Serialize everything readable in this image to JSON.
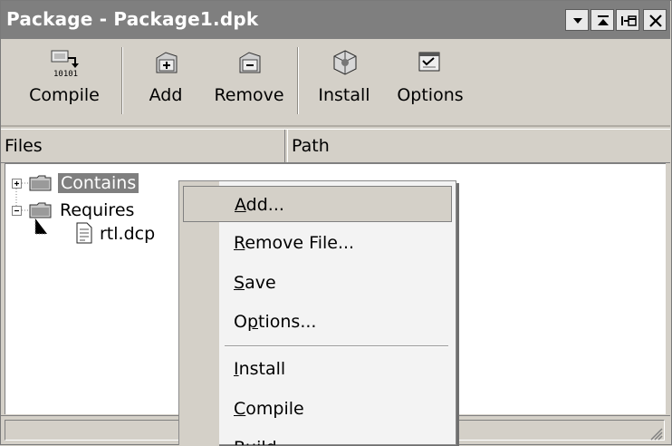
{
  "window": {
    "title": "Package - Package1.dpk",
    "controls": [
      "dropdown-icon",
      "maximize-icon",
      "pin-icon",
      "close-icon"
    ]
  },
  "toolbar": {
    "compile_label": "Compile",
    "add_label": "Add",
    "remove_label": "Remove",
    "install_label": "Install",
    "options_label": "Options"
  },
  "columns": {
    "files": "Files",
    "path": "Path"
  },
  "tree": {
    "items": [
      {
        "label": "Contains",
        "expander": "+",
        "selected": true
      },
      {
        "label": "Requires",
        "expander": "-",
        "selected": false
      },
      {
        "label": "rtl.dcp",
        "child_of": "Requires",
        "visible_label": "rtl.dcp"
      }
    ]
  },
  "context_menu": {
    "items": [
      {
        "label": "Add...",
        "mnemonic": "A",
        "highlighted": true
      },
      {
        "label": "Remove File...",
        "mnemonic": "R"
      },
      {
        "label": "Save",
        "mnemonic": "S"
      },
      {
        "label": "Options...",
        "mnemonic": "p"
      },
      {
        "label": "Install",
        "mnemonic": "I"
      },
      {
        "label": "Compile",
        "mnemonic": "C"
      },
      {
        "label": "Build",
        "mnemonic": "B"
      }
    ]
  },
  "colors": {
    "titlebar": "#7f7f7f",
    "face": "#d4d0c8",
    "selection": "#7f7f7f"
  }
}
